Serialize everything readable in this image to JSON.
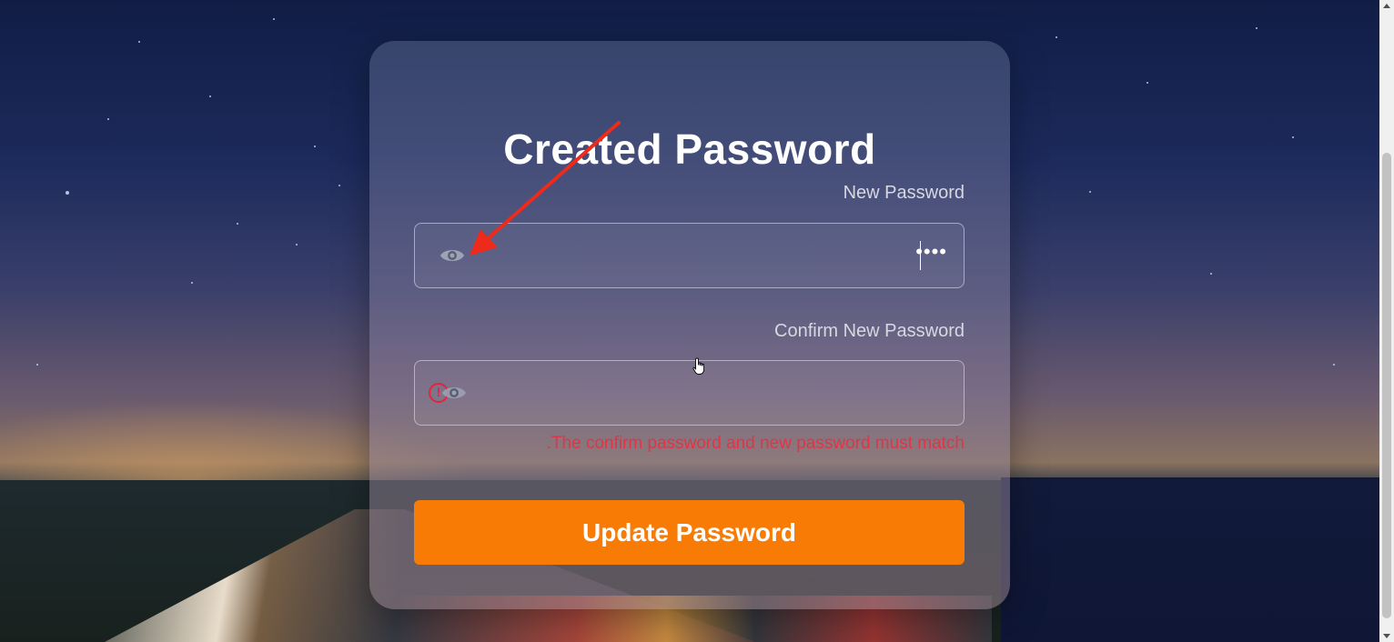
{
  "form": {
    "title": "Created Password",
    "new_password": {
      "label": "New Password",
      "masked_value": "••••",
      "toggle_icon": "eye-icon"
    },
    "confirm_password": {
      "label": "Confirm New Password",
      "masked_value": "",
      "status_icon": "error-circle-icon",
      "toggle_icon": "eye-icon"
    },
    "error_message": ".The confirm password and new password must match",
    "submit_label": "Update Password"
  },
  "colors": {
    "button": "#f77b05",
    "error": "#e33347",
    "annotation_arrow": "#ee2a1b"
  }
}
